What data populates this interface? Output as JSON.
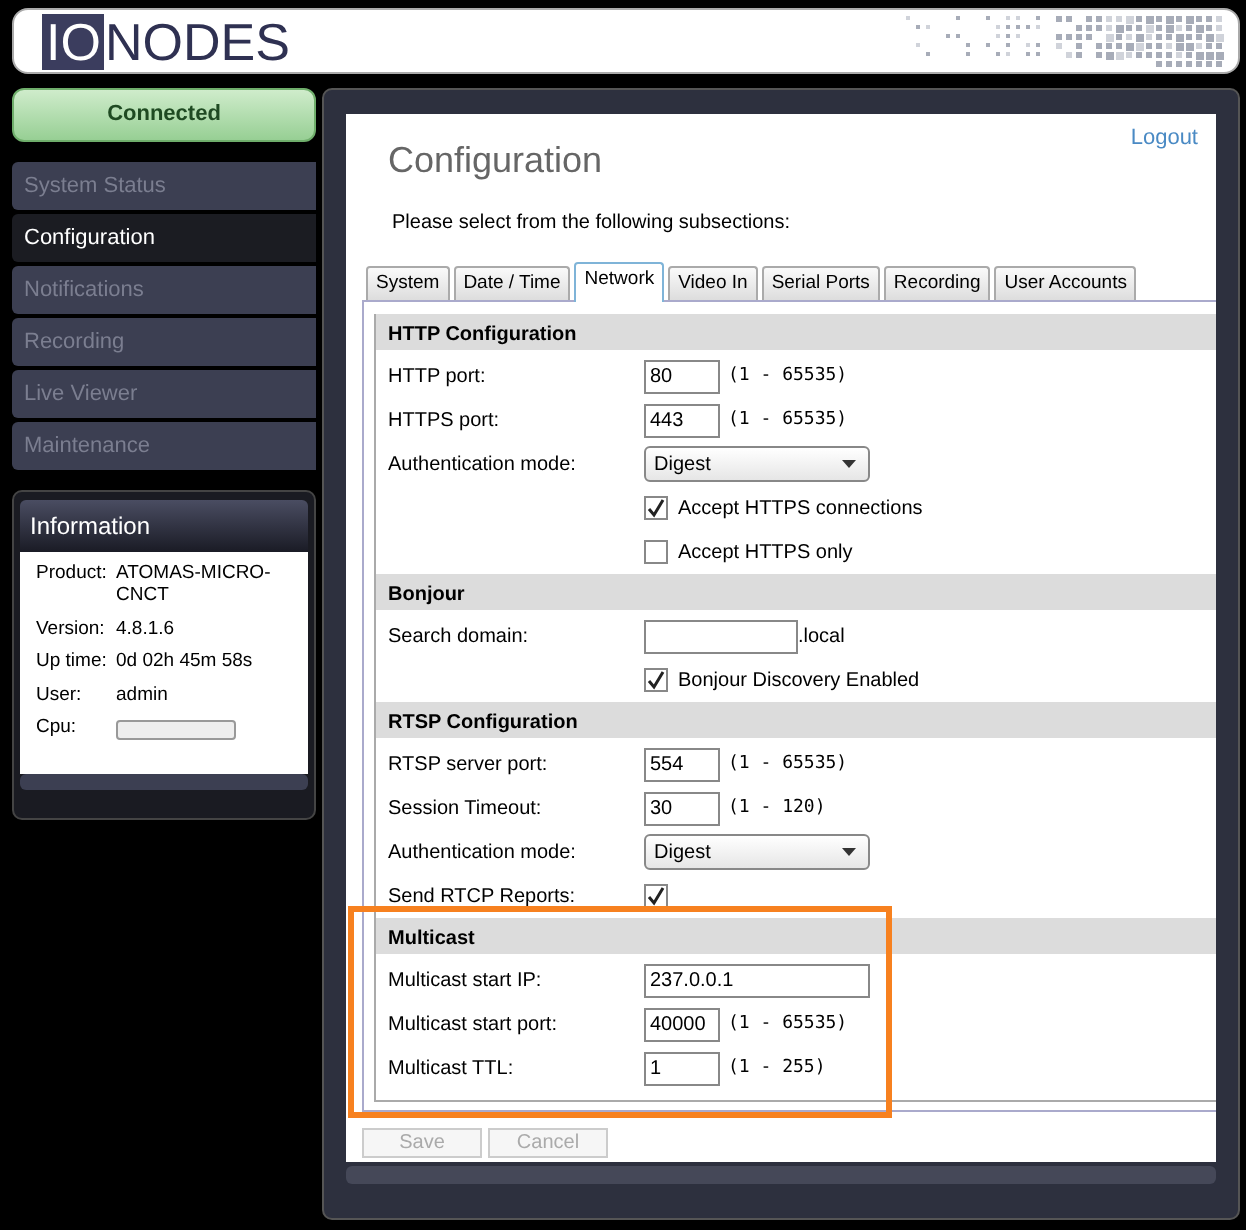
{
  "header": {
    "logo_boxed": "IO",
    "logo_rest": "NODES"
  },
  "sidebar": {
    "status": "Connected",
    "items": [
      {
        "label": "System Status",
        "selected": false
      },
      {
        "label": "Configuration",
        "selected": true
      },
      {
        "label": "Notifications",
        "selected": false
      },
      {
        "label": "Recording",
        "selected": false
      },
      {
        "label": "Live Viewer",
        "selected": false
      },
      {
        "label": "Maintenance",
        "selected": false
      }
    ],
    "information": {
      "title": "Information",
      "rows": [
        {
          "kind": "text",
          "label": "Product:",
          "value": "ATOMAS-MICRO-CNCT"
        },
        {
          "kind": "text",
          "label": "Version:",
          "value": "4.8.1.6"
        },
        {
          "kind": "text",
          "label": "Up time:",
          "value": "0d 02h 45m 58s"
        },
        {
          "kind": "text",
          "label": "User:",
          "value": "admin"
        },
        {
          "kind": "meter",
          "label": "Cpu:",
          "level": 0
        }
      ]
    }
  },
  "main": {
    "title": "Configuration",
    "logout": "Logout",
    "intro": "Please select from the following subsections:",
    "tabs": [
      {
        "label": "System",
        "selected": false
      },
      {
        "label": "Date / Time",
        "selected": false
      },
      {
        "label": "Network",
        "selected": true
      },
      {
        "label": "Video In",
        "selected": false
      },
      {
        "label": "Serial Ports",
        "selected": false
      },
      {
        "label": "Recording",
        "selected": false
      },
      {
        "label": "User Accounts",
        "selected": false
      }
    ],
    "sections": [
      {
        "title": "HTTP Configuration",
        "rows": [
          {
            "kind": "number",
            "label": "HTTP port:",
            "value": "80",
            "range": "(1 - 65535)"
          },
          {
            "kind": "number",
            "label": "HTTPS port:",
            "value": "443",
            "range": "(1 - 65535)"
          },
          {
            "kind": "select",
            "label": "Authentication mode:",
            "value": "Digest"
          },
          {
            "kind": "checkbox",
            "label": "Accept HTTPS connections",
            "checked": true
          },
          {
            "kind": "checkbox",
            "label": "Accept HTTPS only",
            "checked": false
          }
        ]
      },
      {
        "title": "Bonjour",
        "rows": [
          {
            "kind": "suffix",
            "label": "Search domain:",
            "suffix": ".local"
          },
          {
            "kind": "checkbox",
            "label": "Bonjour Discovery Enabled",
            "checked": true
          }
        ]
      },
      {
        "title": "RTSP Configuration",
        "rows": [
          {
            "kind": "number",
            "label": "RTSP server port:",
            "value": "554",
            "range": "(1 - 65535)"
          },
          {
            "kind": "number",
            "label": "Session Timeout:",
            "value": "30",
            "range": "(1 - 120)"
          },
          {
            "kind": "select",
            "label": "Authentication mode:",
            "value": "Digest"
          },
          {
            "kind": "labeled_checkbox",
            "label": "Send RTCP Reports:",
            "checked": true
          }
        ]
      },
      {
        "title": "Multicast",
        "highlighted": true,
        "rows": [
          {
            "kind": "text",
            "label": "Multicast start IP:",
            "value": "237.0.0.1"
          },
          {
            "kind": "number",
            "label": "Multicast start port:",
            "value": "40000",
            "range": "(1 - 65535)"
          },
          {
            "kind": "number",
            "label": "Multicast TTL:",
            "value": "1",
            "range": "(1 - 255)"
          }
        ]
      }
    ],
    "buttons": [
      {
        "label": "Save",
        "disabled": true
      },
      {
        "label": "Cancel",
        "disabled": true
      }
    ]
  }
}
